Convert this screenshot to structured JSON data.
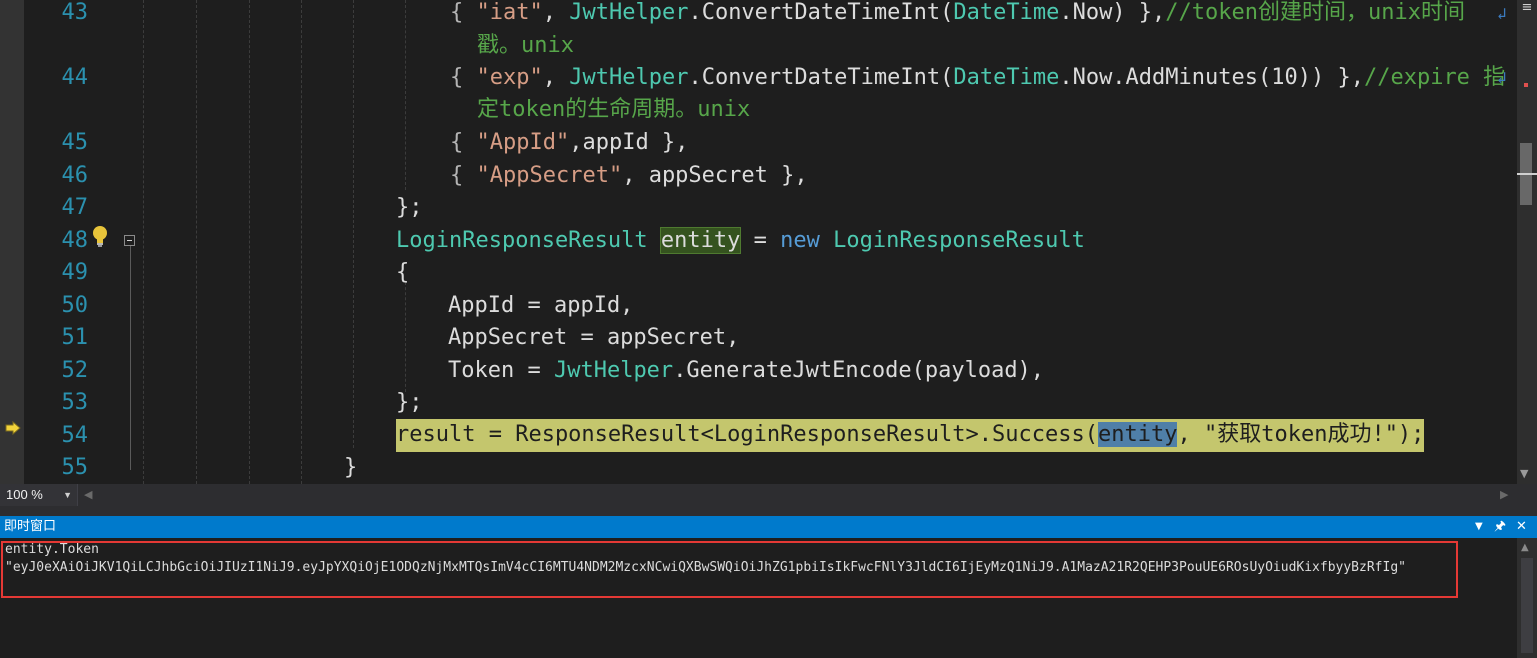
{
  "editor": {
    "lines": [
      {
        "num": "43",
        "parts": [
          {
            "t": "{ ",
            "c": "pun"
          },
          {
            "t": "\"iat\"",
            "c": "str"
          },
          {
            "t": ", ",
            "c": ""
          },
          {
            "t": "JwtHelper",
            "c": "typ"
          },
          {
            "t": ".ConvertDateTimeInt(",
            "c": ""
          },
          {
            "t": "DateTime",
            "c": "typ"
          },
          {
            "t": ".Now) },",
            "c": ""
          },
          {
            "t": "//token创建时间，unix时间",
            "c": "cmt"
          }
        ]
      },
      {
        "num": "",
        "parts": [
          {
            "t": "戳。unix",
            "c": "cmt"
          }
        ]
      },
      {
        "num": "44",
        "parts": [
          {
            "t": "{ ",
            "c": "pun"
          },
          {
            "t": "\"exp\"",
            "c": "str"
          },
          {
            "t": ", ",
            "c": ""
          },
          {
            "t": "JwtHelper",
            "c": "typ"
          },
          {
            "t": ".ConvertDateTimeInt(",
            "c": ""
          },
          {
            "t": "DateTime",
            "c": "typ"
          },
          {
            "t": ".Now.AddMinutes(10)) },",
            "c": ""
          },
          {
            "t": "//expire 指",
            "c": "cmt"
          }
        ]
      },
      {
        "num": "",
        "parts": [
          {
            "t": "定token的生命周期。unix",
            "c": "cmt"
          }
        ]
      },
      {
        "num": "45",
        "parts": [
          {
            "t": "{ ",
            "c": "pun"
          },
          {
            "t": "\"AppId\"",
            "c": "str"
          },
          {
            "t": ",appId },",
            "c": ""
          }
        ]
      },
      {
        "num": "46",
        "parts": [
          {
            "t": "{ ",
            "c": "pun"
          },
          {
            "t": "\"AppSecret\"",
            "c": "str"
          },
          {
            "t": ", appSecret },",
            "c": ""
          }
        ]
      },
      {
        "num": "47",
        "parts": [
          {
            "t": "};",
            "c": ""
          }
        ]
      },
      {
        "num": "48",
        "parts": [
          {
            "t": "LoginResponseResult",
            "c": "typ"
          },
          {
            "t": " ",
            "c": ""
          },
          {
            "t": "entity",
            "c": "ref-hl"
          },
          {
            "t": " = ",
            "c": ""
          },
          {
            "t": "new",
            "c": "kw"
          },
          {
            "t": " ",
            "c": ""
          },
          {
            "t": "LoginResponseResult",
            "c": "typ"
          }
        ]
      },
      {
        "num": "49",
        "parts": [
          {
            "t": "{",
            "c": ""
          }
        ]
      },
      {
        "num": "50",
        "parts": [
          {
            "t": "AppId = appId,",
            "c": ""
          }
        ]
      },
      {
        "num": "51",
        "parts": [
          {
            "t": "AppSecret = appSecret,",
            "c": ""
          }
        ]
      },
      {
        "num": "52",
        "parts": [
          {
            "t": "Token = ",
            "c": ""
          },
          {
            "t": "JwtHelper",
            "c": "typ"
          },
          {
            "t": ".GenerateJwtEncode(payload),",
            "c": ""
          }
        ]
      },
      {
        "num": "53",
        "parts": [
          {
            "t": "};",
            "c": ""
          }
        ]
      },
      {
        "num": "54",
        "parts": [
          {
            "t": "result = ResponseResult<LoginResponseResult>.Success(",
            "c": ""
          },
          {
            "t": "entity",
            "c": "cur-hl"
          },
          {
            "t": ", \"获取token成功!\");",
            "c": ""
          }
        ]
      },
      {
        "num": "55",
        "parts": [
          {
            "t": "}",
            "c": ""
          }
        ]
      }
    ]
  },
  "status": {
    "zoom": "100 %"
  },
  "immediate": {
    "title": "即时窗口",
    "lines": [
      "entity.Token",
      "\"eyJ0eXAiOiJKV1QiLCJhbGciOiJIUzI1NiJ9.eyJpYXQiOjE1ODQzNjMxMTQsImV4cCI6MTU4NDM2MzcxNCwiQXBwSWQiOiJhZG1pbiIsIkFwcFNlY3JldCI6IjEyMzQ1NiJ9.A1MazA21R2QEHP3PouUE6ROsUyOiudKixfbyyBzRfIg\""
    ]
  },
  "colors": {
    "accent": "#007acc",
    "current_line": "#c4c66d",
    "annotation_box": "#e53935"
  }
}
